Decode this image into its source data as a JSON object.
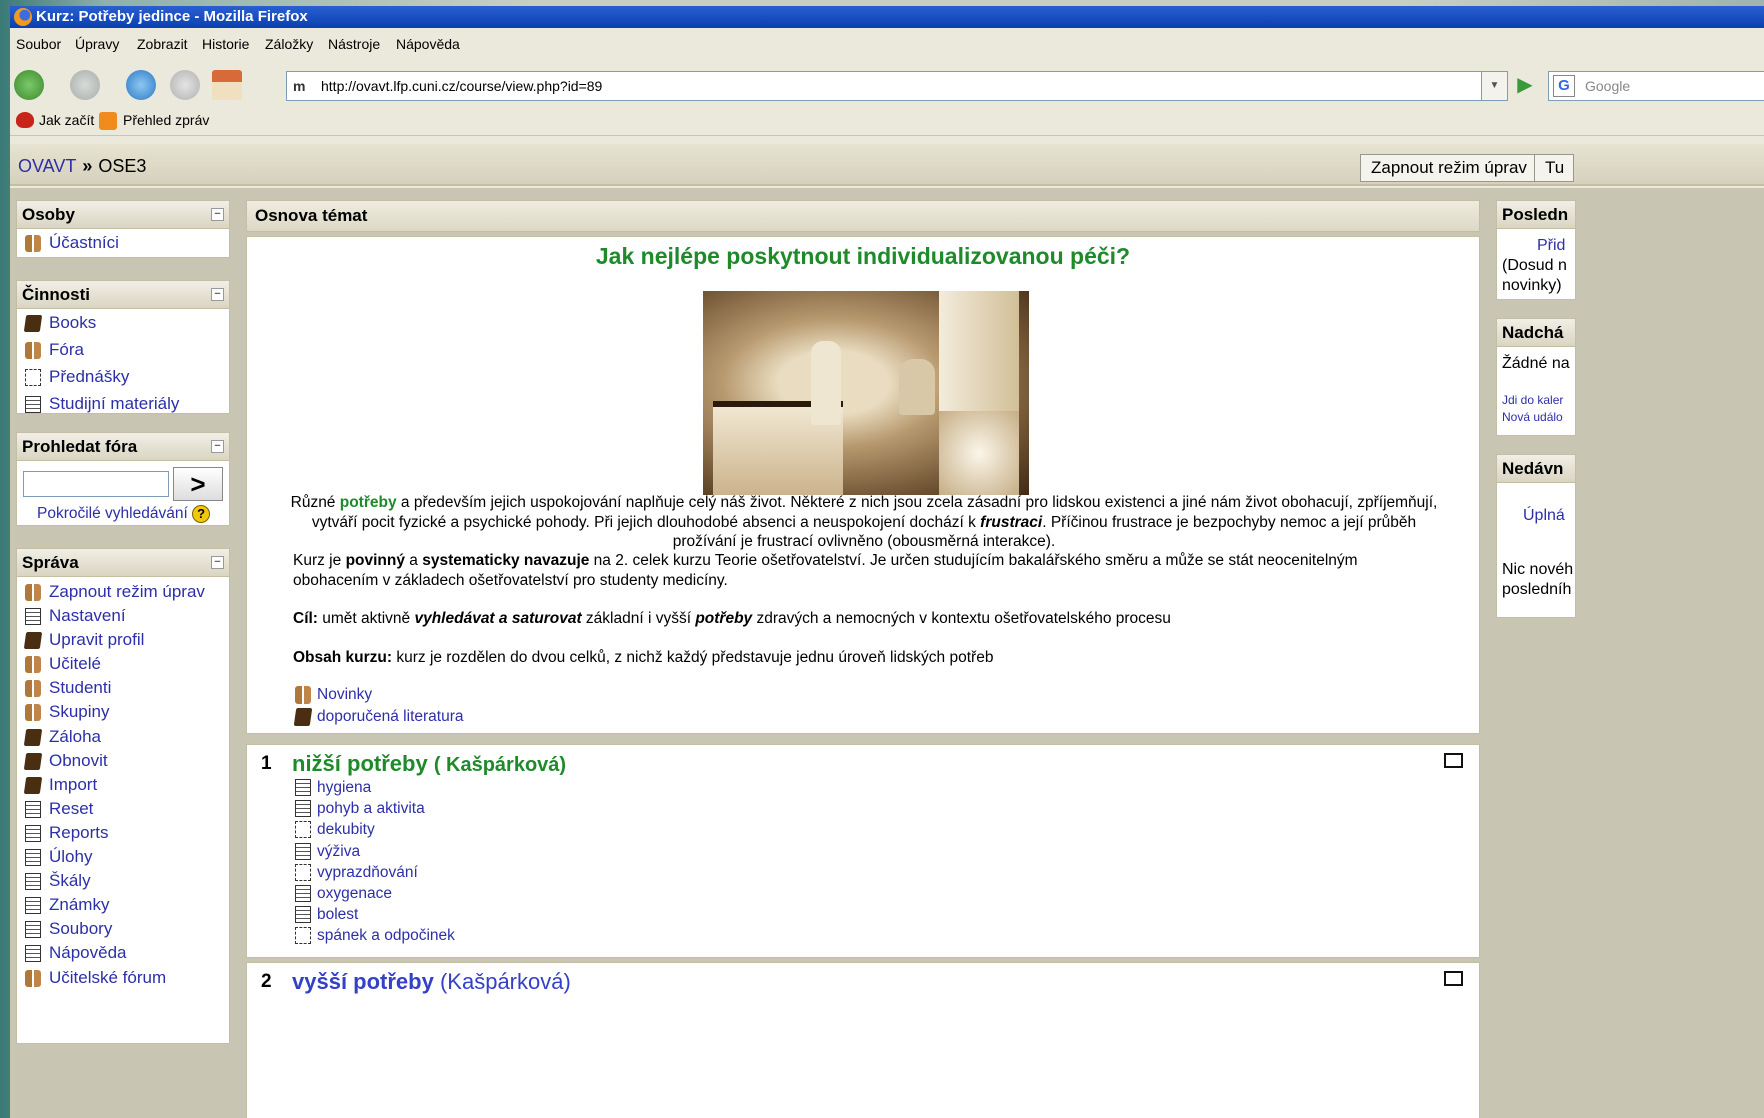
{
  "window": {
    "title": "Kurz: Potřeby jedince - Mozilla Firefox"
  },
  "menu": [
    "Soubor",
    "Úpravy",
    "Zobrazit",
    "Historie",
    "Záložky",
    "Nástroje",
    "Nápověda"
  ],
  "url": "http://ovavt.lfp.cuni.cz/course/view.php?id=89",
  "search_placeholder": "Google",
  "bookmarks": [
    "Jak začít",
    "Přehled zpráv"
  ],
  "breadcrumb": {
    "home": "OVAVT",
    "sep": "»",
    "current": "OSE3"
  },
  "top_buttons": [
    "Zapnout režim úprav",
    "Tu"
  ],
  "left": {
    "osoby": {
      "title": "Osoby",
      "items": [
        "Účastníci"
      ]
    },
    "cinnosti": {
      "title": "Činnosti",
      "items": [
        "Books",
        "Fóra",
        "Přednášky",
        "Studijní materiály"
      ]
    },
    "prohledat": {
      "title": "Prohledat fóra",
      "go": ">",
      "advanced": "Pokročilé vyhledávání",
      "help": "?"
    },
    "sprava": {
      "title": "Správa",
      "items": [
        "Zapnout režim úprav",
        "Nastavení",
        "Upravit profil",
        "Učitelé",
        "Studenti",
        "Skupiny",
        "Záloha",
        "Obnovit",
        "Import",
        "Reset",
        "Reports",
        "Úlohy",
        "Škály",
        "Známky",
        "Soubory",
        "Nápověda",
        "Učitelské fórum"
      ]
    }
  },
  "main": {
    "header": "Osnova témat",
    "title": "Jak nejlépe poskytnout individualizovanou péči?",
    "intro": {
      "p1": "Různé ",
      "w1": "potřeby",
      "p2": " a především jejich uspokojování naplňuje celý náš život. Některé z nich jsou zcela zásadní pro lidskou existenci a jiné nám život obohacují, zpříjemňují, vytváří pocit fyzické a psychické pohody. Při jejich dlouhodobé absenci a neuspokojení dochází k ",
      "w2": "frustraci",
      "p3": ". Příčinou frustrace je bezpochyby nemoc a její průběh prožívání je frustrací ovlivněno (obousměrná interakce)."
    },
    "intro2": {
      "p1": "Kurz je ",
      "b1": "povinný",
      "p2": " a ",
      "b2": "systematicky navazuje",
      "p3": " na 2. celek kurzu Teorie ošetřovatelství. Je určen studujícím bakalářského směru a může se stát neocenitelným obohacením v základech ošetřovatelství pro studenty medicíny."
    },
    "cil": {
      "label": "Cíl:",
      "p1": " umět aktivně ",
      "b1": "vyhledávat a saturovat",
      "p2": " základní i vyšší ",
      "b2": "potřeby",
      "p3": " zdravých a nemocných v kontextu ošetřovatelského procesu"
    },
    "obsah": {
      "label": "Obsah kurzu:",
      "text": " kurz je rozdělen do dvou celků, z nichž každý představuje jednu úroveň lidských potřeb"
    },
    "resources": [
      "Novinky",
      "doporučená literatura"
    ],
    "sections": [
      {
        "num": "1",
        "title": "nižší potřeby",
        "author": "( Kašpárková)",
        "items": [
          "hygiena",
          "pohyb a aktivita",
          "dekubity",
          "výživa",
          "vyprazdňování",
          "oxygenace",
          "bolest",
          "spánek a odpočinek"
        ]
      },
      {
        "num": "2",
        "title": "vyšší  potřeby",
        "author": "(Kašpárková)",
        "items": []
      }
    ]
  },
  "right": {
    "b1": {
      "title": "Posledn",
      "l1": "Přid",
      "l2": "(Dosud n",
      "l3": "novinky)"
    },
    "b2": {
      "title": "Nadchá",
      "l1": "Žádné na",
      "l2": "Jdi do kaler",
      "l3": "Nová událo"
    },
    "b3": {
      "title": "Nedávn",
      "l1": "Úplná",
      "l2": "Nic novéh",
      "l3": "posledníh"
    }
  },
  "colors": {
    "link": "#2d2fa8",
    "green": "#1e8a2a",
    "title_bar": "#0a3fb0"
  }
}
